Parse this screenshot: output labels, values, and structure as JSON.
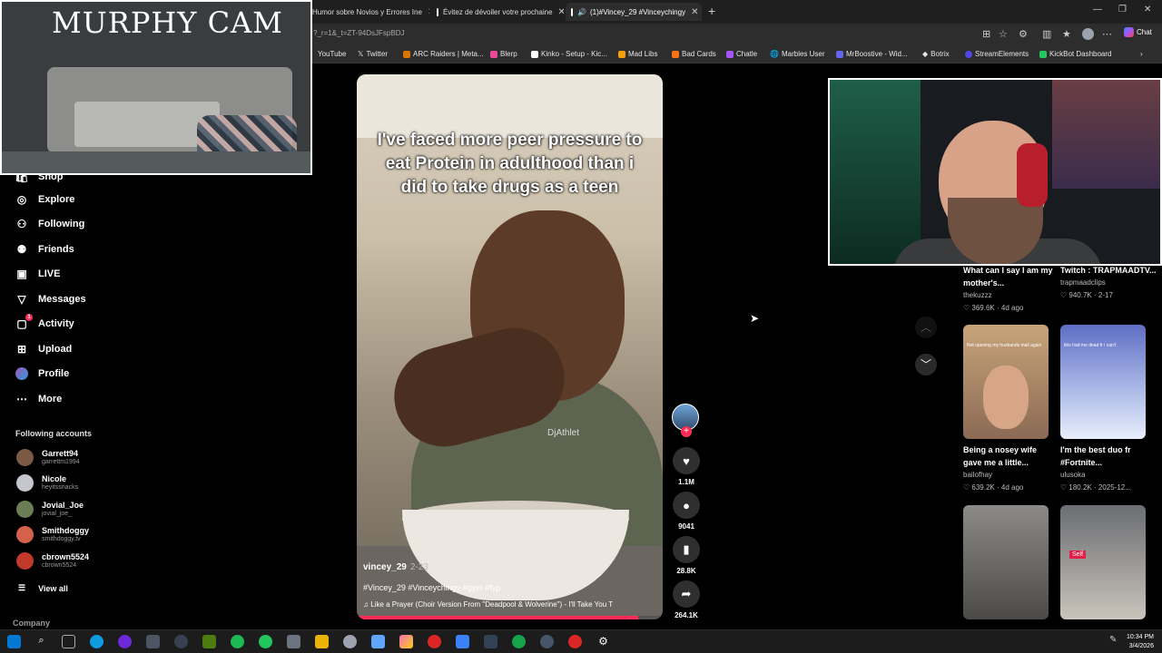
{
  "browser": {
    "tabs": [
      {
        "label": "Humor sobre Novios y Errores Ine"
      },
      {
        "label": "Évitez de dévoiler votre prochaine"
      },
      {
        "label": "(1)#Vincey_29 #Vinceychingy"
      }
    ],
    "url": "?_r=1&_t=ZT-94DsJFspBDJ",
    "chat_label": "Chat",
    "bookmarks": [
      "YouTube",
      "Twitter",
      "ARC Raiders | Meta...",
      "Blerp",
      "Kinko - Setup - Kic...",
      "Mad Libs",
      "Bad Cards",
      "Chatle",
      "Marbles User",
      "MrBoostive - Wid...",
      "Botrix",
      "StreamElements",
      "KickBot Dashboard"
    ]
  },
  "overlay": {
    "murphy_cam_title": "MURPHY CAM"
  },
  "sidebar": {
    "shop_label": "Shop",
    "nav": [
      {
        "label": "Explore",
        "icon": "compass-icon"
      },
      {
        "label": "Following",
        "icon": "following-icon"
      },
      {
        "label": "Friends",
        "icon": "friends-icon"
      },
      {
        "label": "LIVE",
        "icon": "live-icon"
      },
      {
        "label": "Messages",
        "icon": "messages-icon"
      },
      {
        "label": "Activity",
        "icon": "activity-icon",
        "badge": "1"
      },
      {
        "label": "Upload",
        "icon": "upload-icon"
      },
      {
        "label": "Profile",
        "icon": "profile-icon"
      },
      {
        "label": "More",
        "icon": "more-icon"
      }
    ],
    "following_title": "Following accounts",
    "accounts": [
      {
        "name": "Garrett94",
        "handle": "garrettm1994"
      },
      {
        "name": "Nicole",
        "handle": "heyitssnacks"
      },
      {
        "name": "Jovial_Joe",
        "handle": "jovial_joe_"
      },
      {
        "name": "Smithdoggy",
        "handle": "smithdoggy.tv"
      },
      {
        "name": "cbrown5524",
        "handle": "cbrown5524"
      }
    ],
    "view_all": "View all",
    "company": "Company"
  },
  "video": {
    "caption": "I've faced more peer pressure to eat Protein in adulthood than i did to take drugs as a teen",
    "author": "vincey_29",
    "date": "2-23",
    "tags": "#Vincey_29 #Vinceychingy #gym #fyp",
    "music": "Like a Prayer (Choir Version From \"Deadpool & Wolverine\") - I'll Take You T",
    "shirt_text": "DjAthlet",
    "progress": 0.92
  },
  "actions": {
    "likes": "1.1M",
    "comments": "9041",
    "saves": "28.8K",
    "shares": "264.1K"
  },
  "recommendations": [
    {
      "title": "What can I say I am my mother's...",
      "author": "thekuzzz",
      "views": "369.6K",
      "date": "4d ago"
    },
    {
      "title": "Twitch : TRAPMAADTV...",
      "author": "trapmaadclips",
      "views": "940.7K",
      "date": "2-17"
    },
    {
      "title": "Being a nosey wife gave me a little...",
      "author": "bailofhay",
      "views": "639.2K",
      "date": "4d ago",
      "thumb_text": "Not opening my husbands mail again"
    },
    {
      "title": "I'm the best duo fr #Fortnite...",
      "author": "ulusoka",
      "views": "180.2K",
      "date": "2025-12...",
      "thumb_text": "this had me dead fr i can't"
    },
    {
      "thumb_text": "Self"
    }
  ],
  "taskbar": {
    "time": "10:34 PM",
    "date": "3/4/2026"
  },
  "colors": {
    "accent": "#fe2c55",
    "background": "#000000"
  }
}
